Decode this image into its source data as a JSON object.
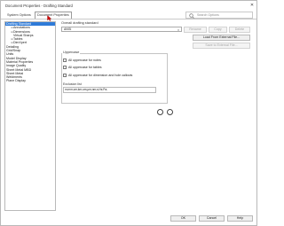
{
  "window": {
    "title": "Document Properties - Drafting Standard",
    "close_glyph": "✕"
  },
  "tabs": [
    {
      "label": "System Options",
      "active": false
    },
    {
      "label": "Document Properties",
      "active": true
    }
  ],
  "search": {
    "placeholder": "Search Options"
  },
  "tree": {
    "items": [
      {
        "label": "Drafting Standard",
        "indent": 0,
        "selected": true,
        "expander": ""
      },
      {
        "label": "Annotations",
        "indent": 1,
        "selected": false,
        "expander": "⊞"
      },
      {
        "label": "Dimensions",
        "indent": 1,
        "selected": false,
        "expander": "⊞"
      },
      {
        "label": "Virtual Sharps",
        "indent": 1,
        "selected": false,
        "expander": ""
      },
      {
        "label": "Tables",
        "indent": 1,
        "selected": false,
        "expander": "⊞"
      },
      {
        "label": "DimXpert",
        "indent": 1,
        "selected": false,
        "expander": "⊞"
      },
      {
        "label": "Detailing",
        "indent": 0,
        "selected": false,
        "expander": ""
      },
      {
        "label": "Grid/Snap",
        "indent": 0,
        "selected": false,
        "expander": ""
      },
      {
        "label": "Units",
        "indent": 0,
        "selected": false,
        "expander": ""
      },
      {
        "label": "Model Display",
        "indent": 0,
        "selected": false,
        "expander": ""
      },
      {
        "label": "Material Properties",
        "indent": 0,
        "selected": false,
        "expander": ""
      },
      {
        "label": "Image Quality",
        "indent": 0,
        "selected": false,
        "expander": ""
      },
      {
        "label": "Sheet Metal MBD",
        "indent": 0,
        "selected": false,
        "expander": ""
      },
      {
        "label": "Sheet Metal",
        "indent": 0,
        "selected": false,
        "expander": ""
      },
      {
        "label": "Weldments",
        "indent": 0,
        "selected": false,
        "expander": ""
      },
      {
        "label": "Plane Display",
        "indent": 0,
        "selected": false,
        "expander": ""
      }
    ]
  },
  "main": {
    "overall_label": "Overall drafting standard",
    "standard_value": "ANSI",
    "buttons": {
      "rename": "Rename",
      "copy": "Copy",
      "delete": "Delete",
      "load_external": "Load From External File...",
      "save_external": "Save to External File..."
    },
    "uppercase": {
      "title": "Uppercase",
      "options": [
        "All uppercase for notes",
        "All uppercase for tables",
        "All uppercase for dimension and hole callouts"
      ],
      "exclusion_label": "Exclusion list",
      "exclusion_value": "m;mm;cm;km;um;μm;nm;s;Hz;Pa;"
    }
  },
  "footer": {
    "ok": "OK",
    "cancel": "Cancel",
    "help": "Help"
  }
}
